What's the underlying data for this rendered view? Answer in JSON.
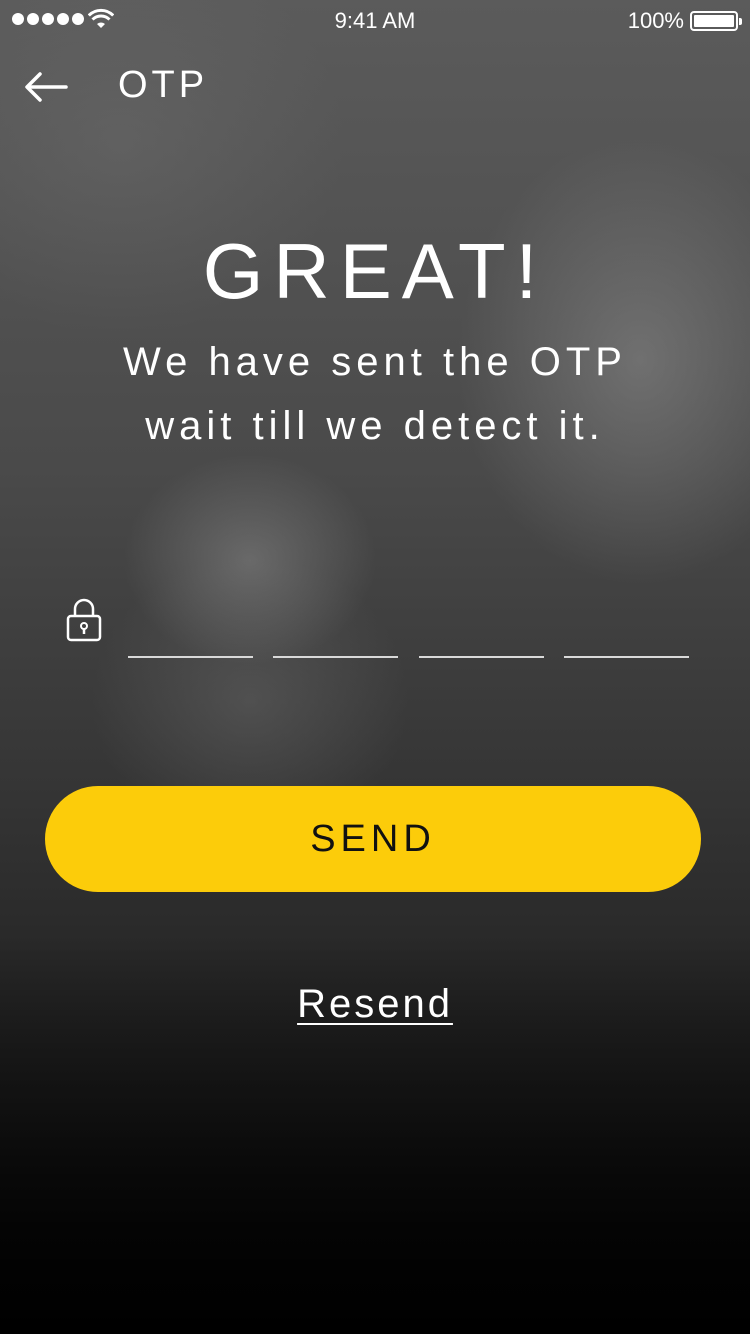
{
  "status_bar": {
    "time": "9:41 AM",
    "battery_percent": "100%",
    "signal_icon": "signal-dots-icon",
    "wifi_icon": "wifi-icon",
    "battery_icon": "battery-icon"
  },
  "nav": {
    "back_icon": "arrow-left-icon",
    "title": "OTP"
  },
  "headline": "GREAT!",
  "subtext": {
    "line1": "We have sent the OTP",
    "line2": "wait till we detect it."
  },
  "otp": {
    "lock_icon": "lock-icon",
    "digits": [
      "",
      "",
      "",
      ""
    ]
  },
  "send_button": "SEND",
  "resend_link": "Resend",
  "colors": {
    "accent": "#fccc0a",
    "text": "#ffffff",
    "button_text": "#111111"
  }
}
